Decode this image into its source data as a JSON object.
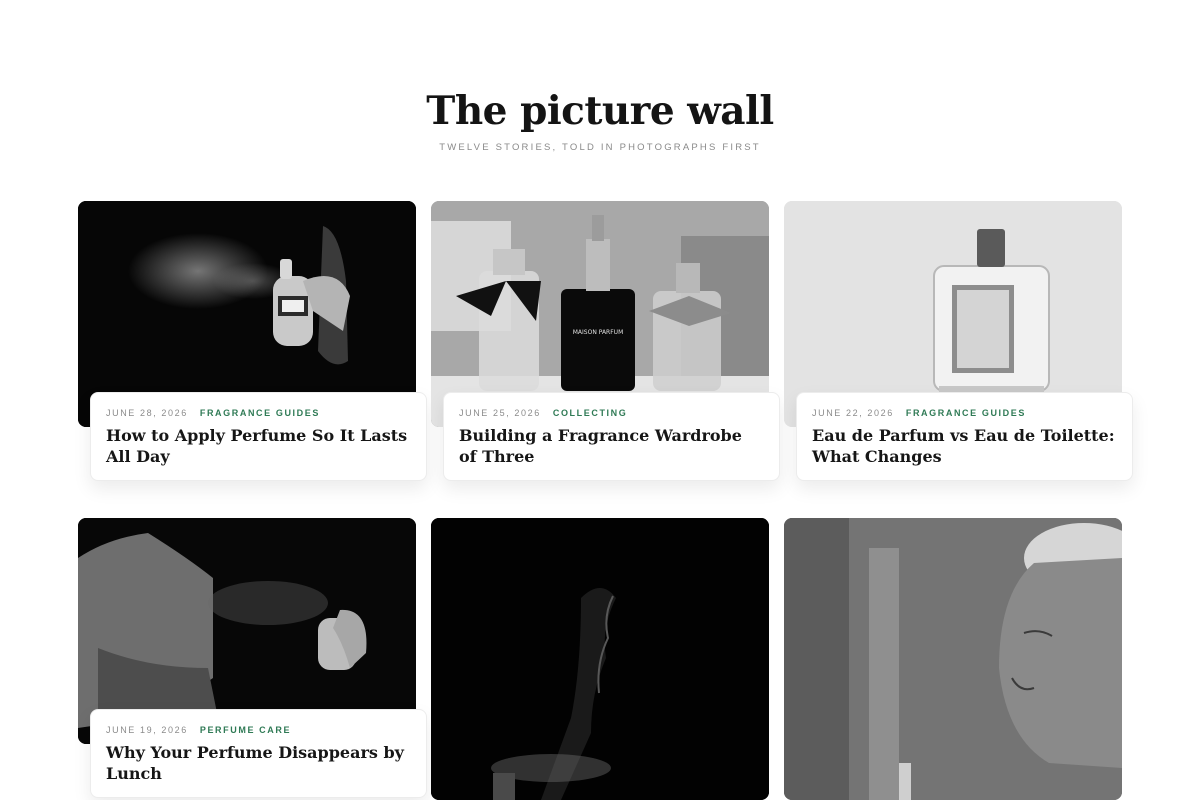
{
  "page": {
    "title": "The picture wall",
    "subtitle": "TWELVE STORIES, TOLD IN PHOTOGRAPHS FIRST"
  },
  "cards": [
    {
      "date": "JUNE 28, 2026",
      "category": "FRAGRANCE GUIDES",
      "headline": "How to Apply Perfume So It Lasts All Day",
      "image": "perfume-spray-dark"
    },
    {
      "date": "JUNE 25, 2026",
      "category": "COLLECTING",
      "headline": "Building a Fragrance Wardrobe of Three",
      "image": "three-perfume-bottles",
      "image_text": "MAISON PARFUM"
    },
    {
      "date": "JUNE 22, 2026",
      "category": "FRAGRANCE GUIDES",
      "headline": "Eau de Parfum vs Eau de Toilette: What Changes",
      "image": "single-perfume-bottle"
    },
    {
      "date": "JUNE 19, 2026",
      "category": "PERFUME CARE",
      "headline": "Why Your Perfume Disappears by Lunch",
      "image": "spraying-neck"
    },
    {
      "image": "silhouette-spray"
    },
    {
      "image": "woman-eyes-closed"
    }
  ],
  "colors": {
    "accent": "#2f7a55",
    "meta": "#8b8b8b",
    "text": "#161616"
  }
}
